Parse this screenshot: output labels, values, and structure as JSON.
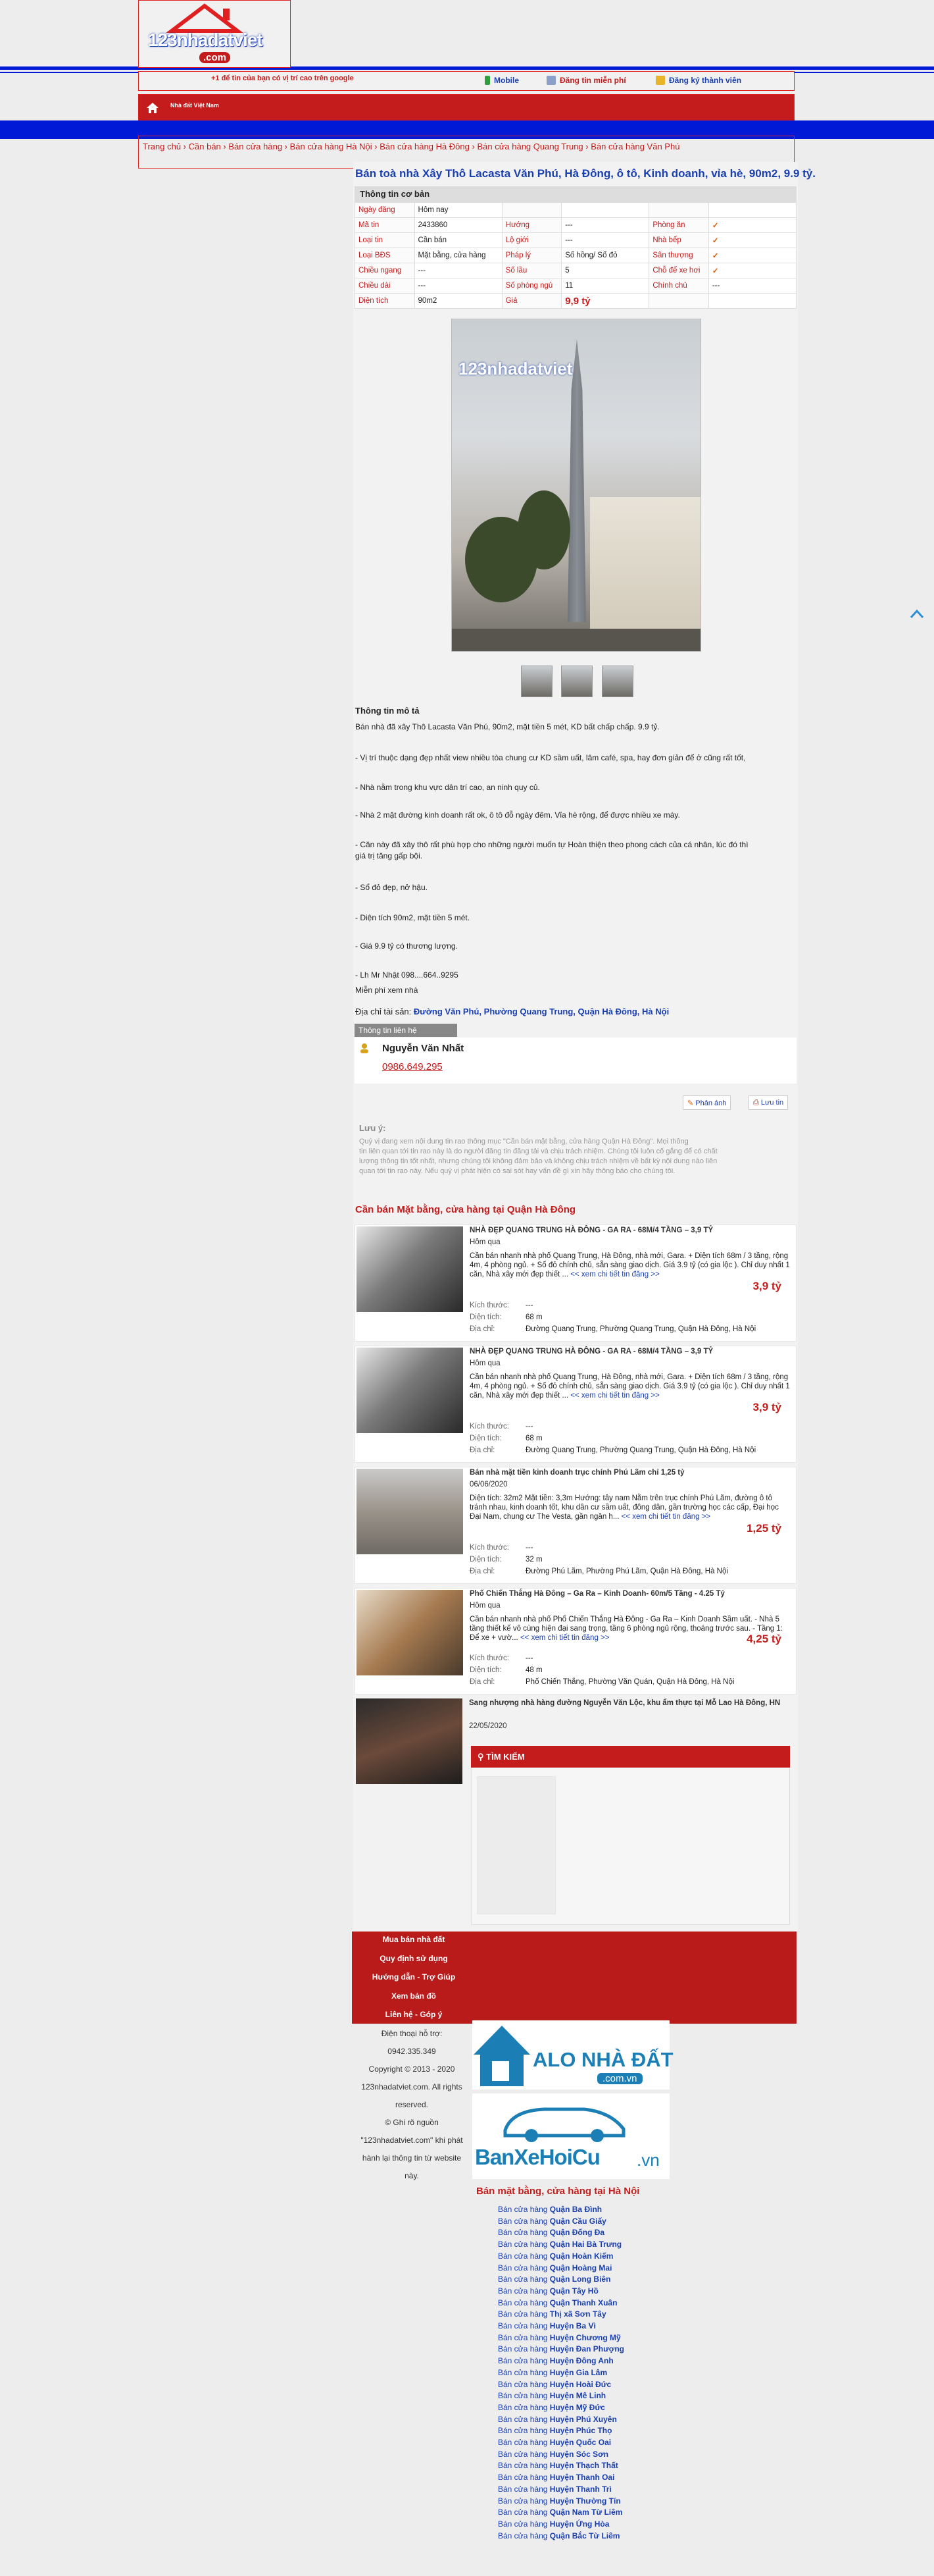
{
  "logo": {
    "text": "123nhadatviet",
    "com": ".com"
  },
  "top_bar": {
    "ad_text": "+1 để tin của bạn có vị trí cao trên google",
    "mobile_label": "Mobile",
    "post_free_label": "Đăng tin miễn phí",
    "register_label": "Đăng ký thành viên"
  },
  "nav": {
    "label": "Nhà đất Việt Nam"
  },
  "breadcrumb": [
    "Trang chủ",
    "Cần bán",
    "Bán cửa hàng",
    "Bán cửa hàng Hà Nội",
    "Bán cửa hàng Hà Đông",
    "Bán cửa hàng Quang Trung",
    "Bán cửa hàng Văn Phú"
  ],
  "listing": {
    "title": "Bán toà nhà Xây Thô Lacasta Văn Phú, Hà Đông, ô tô, Kinh doanh, vỉa hè, 90m2, 9.9 tỷ.",
    "info_header": "Thông tin cơ bản",
    "rows": [
      [
        "Ngày đăng",
        "Hôm nay",
        "",
        "",
        "",
        ""
      ],
      [
        "Mã tin",
        "2433860",
        "Hướng",
        "---",
        "Phòng ăn",
        "✓"
      ],
      [
        "Loại tin",
        "Cần bán",
        "Lộ giới",
        "---",
        "Nhà bếp",
        "✓"
      ],
      [
        "Loại BĐS",
        "Mặt bằng, cửa hàng",
        "Pháp lý",
        "Sổ hồng/ Sổ đỏ",
        "Sân thượng",
        "✓"
      ],
      [
        "Chiều ngang",
        "---",
        "Số lầu",
        "5",
        "Chỗ để xe hơi",
        "✓"
      ],
      [
        "Chiều dài",
        "---",
        "Số phòng ngủ",
        "11",
        "Chính chủ",
        "---"
      ],
      [
        "Diện tích",
        "90m2",
        "Giá",
        "9,9 tỷ",
        "",
        ""
      ]
    ],
    "desc_header": "Thông tin mô tả",
    "desc_lines": [
      "Bán nhà đã xây Thô Lacasta Văn Phú, 90m2, mặt tiền 5 mét, KD bất chấp chấp. 9.9 tỷ.",
      "- Vị trí thuộc dạng đẹp nhất view nhiều tòa chung cư KD sầm uất, lâm café, spa, hay đơn giản để ở cũng rất tốt,",
      "- Nhà nằm trong khu vực dân trí cao, an ninh quy củ.",
      "- Nhà 2 mặt đường kinh doanh rất ok, ô tô đỗ ngày đêm. Vỉa hè rộng, để được nhiều xe máy.",
      "- Căn này đã xây thô rất phù hợp cho những người muốn tự Hoàn thiện theo phong cách của cá nhân, lúc đó thì",
      "giá trị tăng gấp bội.",
      "- Sổ đỏ đẹp, nở hậu.",
      "- Diện tích 90m2, mặt tiền 5 mét.",
      "- Giá 9.9 tỷ có thương lượng.",
      "- Lh Mr Nhật 098....664..9295",
      "Miễn phí xem nhà"
    ],
    "address_label": "Địa chỉ tài sản:",
    "address": "Đường Văn Phú, Phường Quang Trung, Quận Hà Đông, Hà Nội",
    "contact_header": "Thông tin liên hệ",
    "contact_name": "Nguyễn Văn Nhất",
    "contact_phone": "0986.649.295",
    "share_label": "Phản ánh",
    "save_label": "Lưu tin",
    "note_title": "Lưu ý:",
    "note_lines": [
      "Quý vị đang xem nội dung tin rao thông mục \"Cần bán mặt bằng, cửa hàng Quận Hà Đông\". Mọi thông",
      "tin liên quan tới tin rao này là do người đăng tin đăng tải và chịu trách nhiệm. Chúng tôi luôn cố gắng để có chất",
      "lượng thông tin tốt nhất, nhưng chúng tôi không đảm bảo và không chịu trách nhiệm về bất kỳ nội dung nào liên",
      "quan tới tin rao này. Nếu quý vị phát hiện có sai sót hay vấn đề gì xin hãy thông báo cho chúng tôi."
    ]
  },
  "related": {
    "title": "Cần bán Mặt bằng, cửa hàng tại Quận Hà Đông",
    "size_label": "Kích thước:",
    "area_label": "Diện tích:",
    "addr_label": "Địa chỉ:",
    "more_label": "<< xem chi tiết tin đăng >>",
    "items": [
      {
        "title": "NHÀ ĐẸP QUANG TRUNG HÀ ĐÔNG - GA RA - 68M/4 TẦNG – 3,9 TỶ",
        "date": "Hôm qua",
        "summary": "Cần bán nhanh nhà phố Quang Trung, Hà Đông, nhà mới, Gara. + Diện tích 68m / 3 tầng, rộng 4m, 4 phòng ngủ. + Sổ đỏ chính chủ, sẵn sàng giao dịch. Giá 3.9 tỷ (có gia lộc ). Chỉ duy nhất 1 căn, Nhà xây mới đẹp thiết ...",
        "size": "---",
        "area": "68 m",
        "address": "Đường Quang Trung, Phường Quang Trung, Quận Hà Đông, Hà Nội",
        "price": "3,9 tỷ"
      },
      {
        "title": "NHÀ ĐẸP QUANG TRUNG HÀ ĐÔNG - GA RA - 68M/4 TẦNG – 3,9 TỶ",
        "date": "Hôm qua",
        "summary": "Cần bán nhanh nhà phố Quang Trung, Hà Đông, nhà mới, Gara. + Diện tích 68m / 3 tầng, rộng 4m, 4 phòng ngủ. + Sổ đỏ chính chủ, sẵn sàng giao dịch. Giá 3.9 tỷ (có gia lộc ). Chỉ duy nhất 1 căn, Nhà xây mới đẹp thiết ...",
        "size": "---",
        "area": "68 m",
        "address": "Đường Quang Trung, Phường Quang Trung, Quận Hà Đông, Hà Nội",
        "price": "3,9 tỷ"
      },
      {
        "title": "Bán nhà mặt tiền kinh doanh trục chính Phú Lãm chỉ 1,25 tỷ",
        "date": "06/06/2020",
        "summary": "Diện tích: 32m2 Mặt tiền: 3,3m Hướng: tây nam Nằm trên trục chính Phú Lãm, đường ô tô tránh nhau, kinh doanh tốt, khu dân cư sầm uất, đông dân, gần trường học các cấp, Đại học Đại Nam, chung cư The Vesta, gần ngân h...",
        "size": "---",
        "area": "32 m",
        "address": "Đường Phú Lãm, Phường Phú Lãm, Quận Hà Đông, Hà Nội",
        "price": "1,25 tỷ"
      },
      {
        "title": "Phố Chiến Thắng Hà Đông – Ga Ra – Kinh Doanh- 60m/5 Tầng - 4.25 Tỷ",
        "date": "Hôm qua",
        "summary": "Cần bán nhanh nhà phố Phố Chiến Thắng Hà Đông - Ga Ra – Kinh Doanh Sầm uất. - Nhà 5 tầng thiết kế vô cùng hiện đại sang trọng, tầng 6 phòng ngủ rộng, thoáng trước sau. - Tầng 1: Để xe + vườ...",
        "size": "---",
        "area": "48 m",
        "address": "Phố Chiến Thắng, Phường Văn Quán, Quận Hà Đông, Hà Nội",
        "price": "4,25 tỷ"
      }
    ],
    "last_title": "Sang nhượng nhà hàng đường Nguyễn Văn Lộc, khu ẩm thực tại Mỗ Lao Hà Đông, HN",
    "last_date": "22/05/2020"
  },
  "search": {
    "label": "TÌM KIẾM"
  },
  "footer": {
    "menu": [
      "Mua bán nhà đất",
      "Quy định sử dụng",
      "Hướng dẫn - Trợ Giúp",
      "Xem bản đồ",
      "Liên hệ - Góp ý"
    ],
    "lines": [
      "Điện thoại hỗ trợ:",
      "0942.335.349",
      "123nhadatviet.com. All rights",
      "reserved.",
      "Copyright © 2013 - 2020",
      "123nhadatviet.com. All rights",
      "reserved.",
      "© Ghi rõ nguồn",
      "\"123nhadatviet.com\" khi phát",
      "hành lại thông tin từ website",
      "này."
    ],
    "banner1": "ALO NHÀ ĐẤT",
    "banner1_com": ".com.vn",
    "banner2": "BanXeHoiCu",
    "banner2_vn": ".vn"
  },
  "sidebar": {
    "title": "Bán mặt bằng, cửa hàng tại Hà Nội",
    "prefix": "Bán cửa hàng",
    "items": [
      "Quận Ba Đình",
      "Quận Cầu Giấy",
      "Quận Đống Đa",
      "Quận Hai Bà Trưng",
      "Quận Hoàn Kiếm",
      "Quận Hoàng Mai",
      "Quận Long Biên",
      "Quận Tây Hồ",
      "Quận Thanh Xuân",
      "Thị xã Sơn Tây",
      "Huyện Ba Vì",
      "Huyện Chương Mỹ",
      "Huyện Đan Phượng",
      "Huyện Đông Anh",
      "Huyện Gia Lâm",
      "Huyện Hoài Đức",
      "Huyện Mê Linh",
      "Huyện Mỹ Đức",
      "Huyện Phú Xuyên",
      "Huyện Phúc Thọ",
      "Huyện Quốc Oai",
      "Huyện Sóc Sơn",
      "Huyện Thạch Thất",
      "Huyện Thanh Oai",
      "Huyện Thanh Trì",
      "Huyện Thường Tín",
      "Quận Nam Từ Liêm",
      "Huyện Ứng Hòa",
      "Quận Bắc Từ Liêm"
    ]
  },
  "colors": {
    "brand_red": "#c41c1c",
    "link_blue": "#1a3fb0",
    "bar_blue": "#0019d6"
  }
}
